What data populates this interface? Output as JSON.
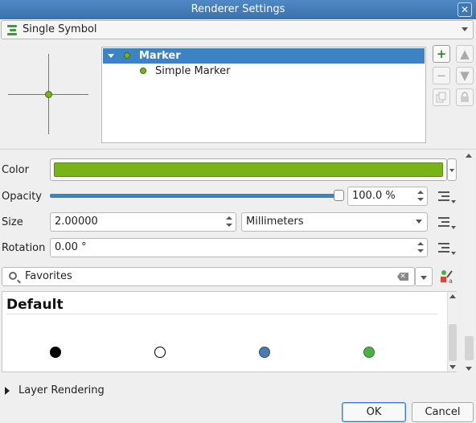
{
  "window": {
    "title": "Renderer Settings",
    "close_glyph": "✕"
  },
  "renderer": {
    "type_label": "Single Symbol",
    "type_icon": "single-symbol-icon"
  },
  "symbol_tree": {
    "items": [
      {
        "label": "Marker",
        "selected": true
      },
      {
        "label": "Simple Marker",
        "selected": false
      }
    ]
  },
  "layer_buttons": {
    "add": "+",
    "remove": "−",
    "move_up": "▲",
    "move_down": "▼"
  },
  "properties": {
    "color": {
      "label": "Color",
      "value": "#7ab317"
    },
    "opacity": {
      "label": "Opacity",
      "value": "100.0 %",
      "fraction": 1.0
    },
    "size": {
      "label": "Size",
      "value": "2.00000",
      "unit": "Millimeters"
    },
    "rotation": {
      "label": "Rotation",
      "value": "0.00 °"
    }
  },
  "library": {
    "search_value": "Favorites",
    "clear_glyph": "✕",
    "group_heading": "Default",
    "symbols": [
      {
        "name": "black-circle",
        "fill": "#000000",
        "stroke": "#000000"
      },
      {
        "name": "white-circle",
        "fill": "#ffffff",
        "stroke": "#000000"
      },
      {
        "name": "blue-circle",
        "fill": "#4a7ab3",
        "stroke": "#2c4f7a"
      },
      {
        "name": "green-circle",
        "fill": "#4caf45",
        "stroke": "#2f7a2a"
      }
    ]
  },
  "layer_rendering": {
    "label": "Layer Rendering"
  },
  "buttons": {
    "ok": "OK",
    "cancel": "Cancel"
  }
}
